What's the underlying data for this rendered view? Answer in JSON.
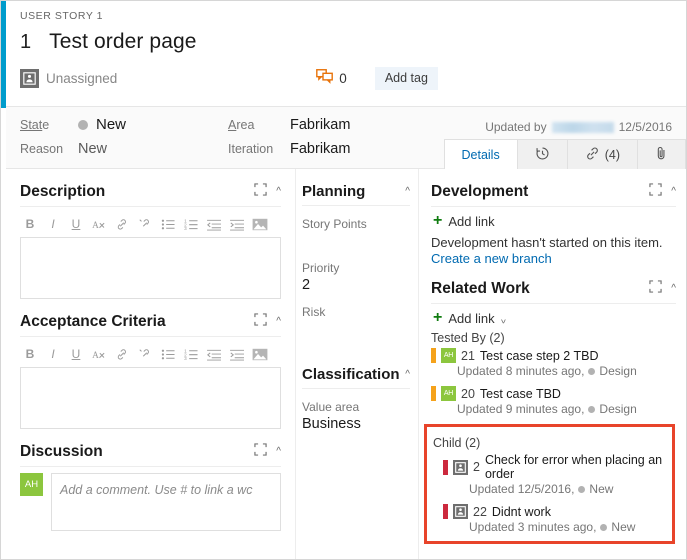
{
  "header": {
    "overline": "USER STORY 1",
    "id": "1",
    "title": "Test order page",
    "assignee": "Unassigned",
    "assignee_icon": "person-avatar-icon",
    "comment_icon": "comment-icon",
    "comment_count": "0",
    "add_tag_label": "Add tag"
  },
  "fields": {
    "state_label": "State",
    "state_value": "New",
    "reason_label": "Reason",
    "reason_value": "New",
    "area_label": "Area",
    "area_value": "Fabrikam",
    "iteration_label": "Iteration",
    "iteration_value": "Fabrikam",
    "updated_by_label": "Updated by",
    "updated_by_user": "",
    "updated_date": "12/5/2016"
  },
  "tabs": [
    {
      "label": "Details",
      "icon": "",
      "active": true
    },
    {
      "label": "",
      "icon": "history-clock-icon",
      "active": false
    },
    {
      "label": "(4)",
      "icon": "link-icon",
      "active": false
    },
    {
      "label": "",
      "icon": "paperclip-attachment-icon",
      "active": false
    }
  ],
  "description": {
    "title": "Description",
    "expand_icon": "expand-icon",
    "collapse_icon": "chevron-up-icon",
    "toolbar": [
      "bold-icon",
      "italic-icon",
      "underline-icon",
      "clear-format-icon",
      "link-icon",
      "unlink-icon",
      "bullet-list-icon",
      "numbered-list-icon",
      "outdent-icon",
      "indent-icon",
      "image-icon"
    ],
    "value": ""
  },
  "acceptance_criteria": {
    "title": "Acceptance Criteria",
    "value": ""
  },
  "discussion": {
    "title": "Discussion",
    "avatar_initials": "AH",
    "placeholder": "Add a comment. Use # to link a wc"
  },
  "planning": {
    "title": "Planning",
    "fields": [
      {
        "label": "Story Points",
        "value": ""
      },
      {
        "label": "Priority",
        "value": "2"
      },
      {
        "label": "Risk",
        "value": ""
      }
    ]
  },
  "classification": {
    "title": "Classification",
    "fields": [
      {
        "label": "Value area",
        "value": "Business"
      }
    ]
  },
  "development": {
    "title": "Development",
    "add_link_label": "Add link",
    "status_text": "Development hasn't started on this item.",
    "branch_link": "Create a new branch"
  },
  "related_work": {
    "title": "Related Work",
    "add_link_label": "Add link",
    "groups": [
      {
        "name": "tested-by",
        "label": "Tested By (2)",
        "highlighted": false,
        "items": [
          {
            "id": "21",
            "title": "Test case step 2 TBD",
            "bar_color": "#f5a21b",
            "avatar": "AH",
            "avatar_kind": "green",
            "updated": "Updated 8 minutes ago,",
            "state": "Design"
          },
          {
            "id": "20",
            "title": "Test case TBD",
            "bar_color": "#f5a21b",
            "avatar": "AH",
            "avatar_kind": "green",
            "updated": "Updated 9 minutes ago,",
            "state": "Design"
          }
        ]
      },
      {
        "name": "child",
        "label": "Child (2)",
        "highlighted": true,
        "items": [
          {
            "id": "2",
            "title": "Check for error when placing an order",
            "bar_color": "#cc293d",
            "avatar": "",
            "avatar_kind": "gray",
            "updated": "Updated 12/5/2016,",
            "state": "New"
          },
          {
            "id": "22",
            "title": "Didnt work",
            "bar_color": "#cc293d",
            "avatar": "",
            "avatar_kind": "gray",
            "updated": "Updated 3 minutes ago,",
            "state": "New"
          }
        ]
      }
    ]
  },
  "colors": {
    "accent": "#009ccc",
    "link": "#006ab1",
    "highlight": "#e8442a",
    "add_green": "#107c10",
    "avatar_green": "#8cc63e",
    "bar_orange": "#f5a21b",
    "bar_red": "#cc293d"
  }
}
